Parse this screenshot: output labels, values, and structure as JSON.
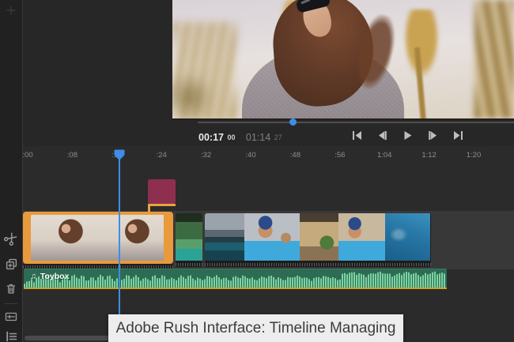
{
  "app": {
    "name": "Adobe Rush"
  },
  "caption": {
    "text": "Adobe Rush Interface: Timeline Managing"
  },
  "monitor": {
    "timecode": {
      "current": "00:17",
      "current_frames": "00",
      "total": "01:14",
      "total_frames": "27"
    },
    "transport": {
      "skip_start": "Skip to start",
      "step_back": "Step back one frame",
      "play": "Play",
      "step_forward": "Step forward one frame",
      "skip_end": "Skip to end"
    },
    "scrubber_label": "Playback scrubber"
  },
  "timeline": {
    "ruler_ticks": [
      ":00",
      ":08",
      ":16",
      ":24",
      ":32",
      ":40",
      ":48",
      ":56",
      "1:04",
      "1:12",
      "1:20"
    ],
    "video_track": {
      "clips": [
        {
          "name": "clip-1",
          "selected": true,
          "thumbs": [
            "woman-portrait",
            "woman-portrait"
          ]
        },
        {
          "name": "clip-2",
          "selected": false,
          "thumbs": [
            "jungle-lake"
          ]
        },
        {
          "name": "clip-3",
          "selected": false,
          "thumbs": [
            "mountain-lake",
            "selfie-blue",
            "courtyard",
            "selfie-house",
            "underwater"
          ]
        }
      ]
    },
    "audio_track": {
      "label": "Toybox",
      "icon": "music-note-icon",
      "note_glyph": "♫"
    },
    "title_clip": {
      "name": "title-graphic",
      "color": "#8E2F50"
    },
    "playhead_label": "Playhead"
  },
  "sidebar": {
    "tools": [
      {
        "label": "Add media",
        "icon": "plus-icon"
      },
      {
        "label": "Split clip",
        "icon": "scissors-icon"
      },
      {
        "label": "Duplicate clip",
        "icon": "duplicate-icon"
      },
      {
        "label": "Delete clip",
        "icon": "trash-icon"
      },
      {
        "label": "Audio mixer",
        "icon": "mixer-panel-icon"
      },
      {
        "label": "Track options",
        "icon": "track-list-icon"
      }
    ]
  },
  "colors": {
    "accent_orange": "#E89A3C",
    "playhead_blue": "#3E8DE8",
    "title_maroon": "#8E2F50",
    "audio_green": "#2F6E54",
    "waveform_green": "#7BD3A2",
    "audio_underline": "#C9A227"
  }
}
